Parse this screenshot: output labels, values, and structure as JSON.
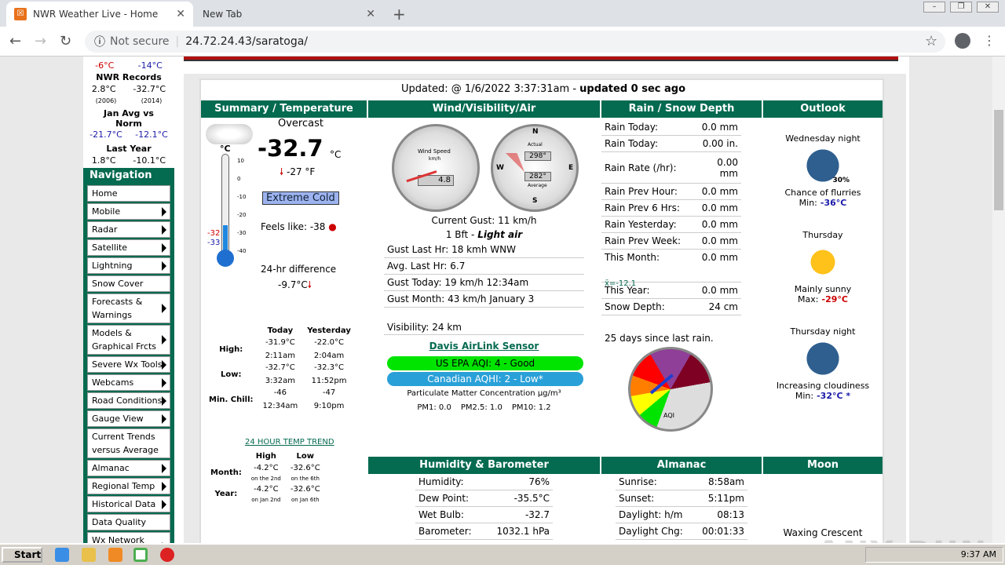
{
  "browser": {
    "tabs": [
      {
        "title": "NWR Weather Live - Home"
      },
      {
        "title": "New Tab"
      }
    ],
    "not_secure": "Not secure",
    "url": "24.72.24.43/saratoga/"
  },
  "sidebar": {
    "top_values": {
      "low_left": "-6°C",
      "low_right": "-14°C"
    },
    "records": {
      "title": "NWR Records",
      "left": "2.8°C",
      "right": "-32.7°C",
      "left_year": "(2006)",
      "right_year": "(2014)"
    },
    "avg": {
      "title": "Jan Avg vs Norm",
      "left": "-21.7°C",
      "right": "-12.1°C"
    },
    "lastyear": {
      "title": "Last Year",
      "left": "1.8°C",
      "right": "-10.1°C"
    },
    "nav_title": "Navigation",
    "nav_items": [
      {
        "label": "Home",
        "arrow": false
      },
      {
        "label": "Mobile",
        "arrow": true
      },
      {
        "label": "Radar",
        "arrow": true
      },
      {
        "label": "Satellite",
        "arrow": true
      },
      {
        "label": "Lightning",
        "arrow": true
      },
      {
        "label": "Snow Cover",
        "arrow": false
      },
      {
        "label": "Forecasts & Warnings",
        "arrow": true
      },
      {
        "label": "Models & Graphical Frcts",
        "arrow": true
      },
      {
        "label": "Severe Wx Tools",
        "arrow": true
      },
      {
        "label": "Webcams",
        "arrow": true
      },
      {
        "label": "Road Conditions",
        "arrow": true
      },
      {
        "label": "Gauge View",
        "arrow": true
      },
      {
        "label": "Current Trends versus Average",
        "arrow": false
      },
      {
        "label": "Almanac",
        "arrow": true
      },
      {
        "label": "Regional Temp",
        "arrow": true
      },
      {
        "label": "Historical Data",
        "arrow": true
      },
      {
        "label": "Data Quality",
        "arrow": false
      },
      {
        "label": "Wx Network Affiliations",
        "arrow": true
      }
    ]
  },
  "updated": {
    "prefix": "Updated: @ 1/6/2022 3:37:31am - ",
    "suffix": "updated 0 sec ago"
  },
  "summary": {
    "header": "Summary / Temperature",
    "condition": "Overcast",
    "temp": "-32.7",
    "temp_unit": "°C",
    "temp_f": "-27 °F",
    "badge": "Extreme Cold",
    "feels": "Feels like: -38",
    "diff_label": "24-hr difference",
    "diff_value": "-9.7°C",
    "thermo_top": "°C",
    "thermo_ticks": [
      "10",
      "0",
      "-10",
      "-20",
      "-30",
      "-40"
    ],
    "thermo_marks": {
      "a": "-32",
      "b": "-33"
    },
    "hl_headers": [
      "Today",
      "Yesterday"
    ],
    "hl_rows": [
      {
        "label": "High:",
        "today": "-31.9°C",
        "today_t": "2:11am",
        "yest": "-22.0°C",
        "yest_t": "2:04am"
      },
      {
        "label": "Low:",
        "today": "-32.7°C",
        "today_t": "3:32am",
        "yest": "-32.3°C",
        "yest_t": "11:52pm"
      },
      {
        "label": "Min. Chill:",
        "today": "-46",
        "today_t": "12:34am",
        "yest": "-47",
        "yest_t": "9:10pm"
      }
    ],
    "trend_link": "24 HOUR TEMP TREND",
    "mhl_headers": [
      "High",
      "Low"
    ],
    "mhl_rows": [
      {
        "label": "Month:",
        "high": "-4.2°C",
        "high_t": "on the 2nd",
        "low": "-32.6°C",
        "low_t": "on the 6th"
      },
      {
        "label": "Year:",
        "high": "-4.2°C",
        "high_t": "on Jan 2nd",
        "low": "-32.6°C",
        "low_t": "on Jan 6th"
      }
    ]
  },
  "wind": {
    "header": "Wind/Visibility/Air",
    "gauge1_value": "4.8",
    "gauge1_label": "Wind Speed",
    "gauge1_unit": "km/h",
    "gauge2_a": "298°",
    "gauge2_b": "282°",
    "gauge2_label": "Actual",
    "gauge2_sub": "Average",
    "gust_current": "Current Gust: 11 km/h",
    "bft_prefix": "1 Bft - ",
    "bft_desc": "Light air",
    "rows": [
      "Gust Last Hr: 18 kmh WNW",
      "Avg. Last Hr: 6.7",
      "Gust Today: 19 km/h 12:34am",
      "Gust Month: 43 km/h January 3"
    ],
    "visibility": "Visibility: 24 km",
    "airlink": "Davis AirLink Sensor",
    "epa": "US EPA AQI: 4 - Good",
    "canadian": "Canadian AQHI: 2 - Low*",
    "pm_title": "Particulate Matter Concentration µg/m³",
    "pm1": "PM1: 0.0",
    "pm25": "PM2.5: 1.0",
    "pm10": "PM10: 1.2"
  },
  "rain": {
    "header": "Rain / Snow Depth",
    "rows": [
      {
        "k": "Rain Today:",
        "v": "0.0 mm"
      },
      {
        "k": "Rain Today:",
        "v": "0.00  in."
      },
      {
        "k": "Rain Rate (/hr):",
        "v": "0.00 mm"
      },
      {
        "k": "Rain Prev Hour:",
        "v": "0.0 mm"
      },
      {
        "k": "Rain Prev 6 Hrs:",
        "v": "0.0 mm"
      },
      {
        "k": "Rain Yesterday:",
        "v": "0.0 mm"
      },
      {
        "k": "Rain Prev Week:",
        "v": "0.0 mm"
      },
      {
        "k": "This Month:",
        "v": "0.0 mm"
      },
      {
        "k": "This Year:",
        "v": "0.0 mm"
      },
      {
        "k": "Snow Depth:",
        "v": "24 cm"
      }
    ],
    "month_avg": "x̄=-12.1",
    "since": "25 days since last rain.",
    "aqi_gauge_label": "AQI"
  },
  "outlook": {
    "header": "Outlook",
    "items": [
      {
        "period": "Wednesday night",
        "pct": "30%",
        "desc": "Chance of flurries",
        "temp_label": "Min:",
        "temp": "-36°C",
        "temp_color": "#1a1aa8"
      },
      {
        "period": "Thursday",
        "pct": "",
        "desc": "Mainly sunny",
        "temp_label": "Max:",
        "temp": "-29°C",
        "temp_color": "#c00"
      },
      {
        "period": "Thursday night",
        "pct": "",
        "desc": "Increasing cloudiness",
        "temp_label": "Min:",
        "temp": "-32°C *",
        "temp_color": "#1a1aa8"
      }
    ]
  },
  "humidity": {
    "header": "Humidity & Barometer",
    "rows": [
      {
        "k": "Humidity:",
        "v": "76%"
      },
      {
        "k": "Dew Point:",
        "v": "-35.5°C"
      },
      {
        "k": "Wet Bulb:",
        "v": "-32.7"
      },
      {
        "k": "Barometer:",
        "v": "1032.1 hPa"
      }
    ]
  },
  "almanac": {
    "header": "Almanac",
    "rows": [
      {
        "k": "Sunrise:",
        "v": "8:58am"
      },
      {
        "k": "Sunset:",
        "v": "5:11pm"
      },
      {
        "k": "Daylight: h/m",
        "v": "08:13"
      },
      {
        "k": "Daylight Chg:",
        "v": "00:01:33"
      }
    ]
  },
  "moon": {
    "header": "Moon",
    "phase": "Waxing Crescent"
  },
  "taskbar": {
    "start": "Start",
    "clock": "9:37 AM"
  },
  "watermark": "ANY RUN"
}
